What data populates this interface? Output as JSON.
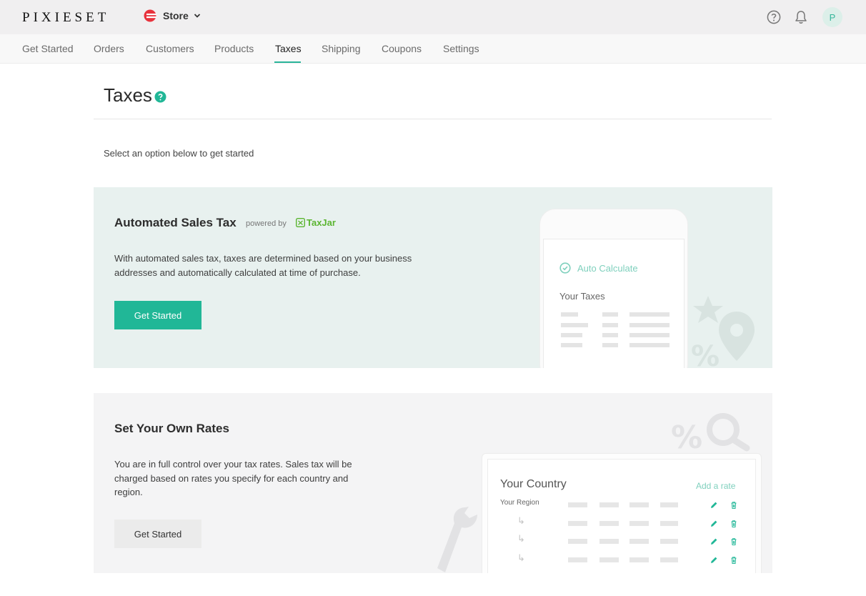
{
  "topbar": {
    "logo_text": "PIXIESET",
    "store_label": "Store",
    "icons": [
      "store-logo-icon",
      "chevron-down-icon",
      "help-circle-icon",
      "bell-icon"
    ],
    "avatar_initial": "P"
  },
  "nav": {
    "items": [
      {
        "label": "Get Started"
      },
      {
        "label": "Orders"
      },
      {
        "label": "Customers"
      },
      {
        "label": "Products"
      },
      {
        "label": "Taxes"
      },
      {
        "label": "Shipping"
      },
      {
        "label": "Coupons"
      },
      {
        "label": "Settings"
      }
    ],
    "active": "Taxes"
  },
  "page": {
    "title": "Taxes",
    "intro": "Select an option below to get started"
  },
  "automated": {
    "title": "Automated Sales Tax",
    "powered_by": "powered by",
    "brand": "TaxJar",
    "description": "With automated sales tax, taxes are determined based on your business addresses and automatically calculated at time of purchase.",
    "button_label": "Get Started",
    "illustration": {
      "auto_calculate": "Auto Calculate",
      "your_taxes": "Your Taxes"
    }
  },
  "own_rates": {
    "title": "Set Your Own Rates",
    "description": "You are in full control over your tax rates. Sales tax will be charged based on rates you specify for each country and region.",
    "button_label": "Get Started",
    "illustration": {
      "your_country": "Your Country",
      "add_rate": "Add a rate",
      "your_region": "Your Region",
      "arrow": "↳"
    }
  },
  "colors": {
    "accent": "#21b797",
    "accent_light": "#7fd0bd",
    "card_green": "#e8f1ef",
    "card_gray": "#f4f4f5",
    "taxjar_green": "#5bb531"
  }
}
